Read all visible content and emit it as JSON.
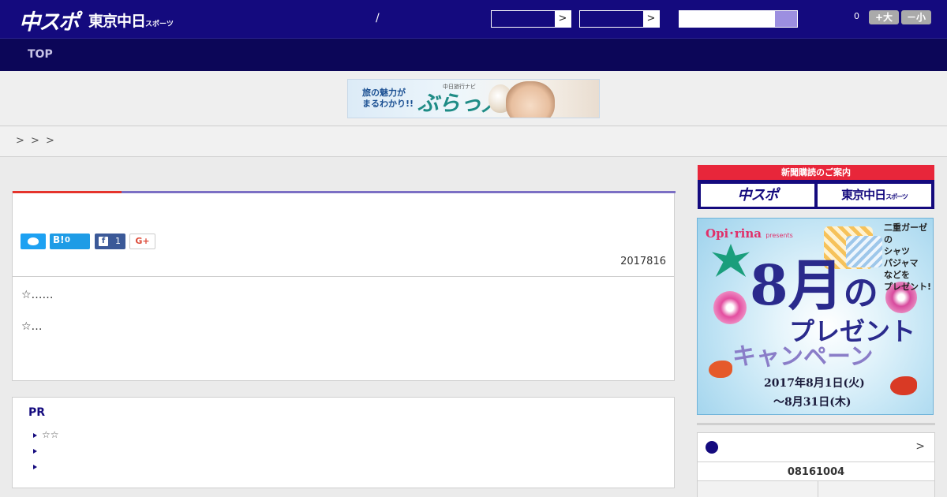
{
  "header": {
    "logo_chuspo": "中スポ",
    "logo_tokyo": "東京中日",
    "logo_tokyo_small": "スポーツ",
    "slash": "/",
    "select_arrow": ">",
    "font_count": "0",
    "font_larger": "+大",
    "font_smaller": "－小",
    "colors": {
      "header_bg": "#140a7e",
      "nav_bg": "#0c0658"
    }
  },
  "nav": {
    "top": "TOP"
  },
  "ad": {
    "text": "旅の魅力が\nまるわかり!!",
    "brand_small": "中日旅行ナビ",
    "brand": "ぶらっ人"
  },
  "breadcrumb": {
    "separators": [
      ">",
      ">",
      ">"
    ]
  },
  "article": {
    "share": {
      "hatena_label": "B!",
      "hatena_count": "0",
      "facebook_count": "1",
      "gplus_label": "G+"
    },
    "date": "2017816",
    "body_line1": "☆……",
    "body_line2": "☆…"
  },
  "pr": {
    "title": "PR",
    "items": [
      "☆☆",
      "",
      ""
    ]
  },
  "sidebar": {
    "subscribe": {
      "header": "新聞購読のご案内",
      "left_button": "中スポ",
      "right_button": "東京中日",
      "right_button_small": "スポーツ"
    },
    "campaign": {
      "brand": "Opi･rina",
      "brand_small": "presents",
      "gift_text": "二重ガーゼの\nシャツ\nパジャマ\nなどを\nプレゼント!",
      "big_text": "8月",
      "big_text_small": "の",
      "subtitle1": "プレゼント",
      "subtitle2": "キャンペーン",
      "date_line1": "2017年8月1日(火)",
      "date_line2": "〜8月31日(木)"
    },
    "schedule": {
      "more": ">",
      "date": "08161004"
    }
  }
}
